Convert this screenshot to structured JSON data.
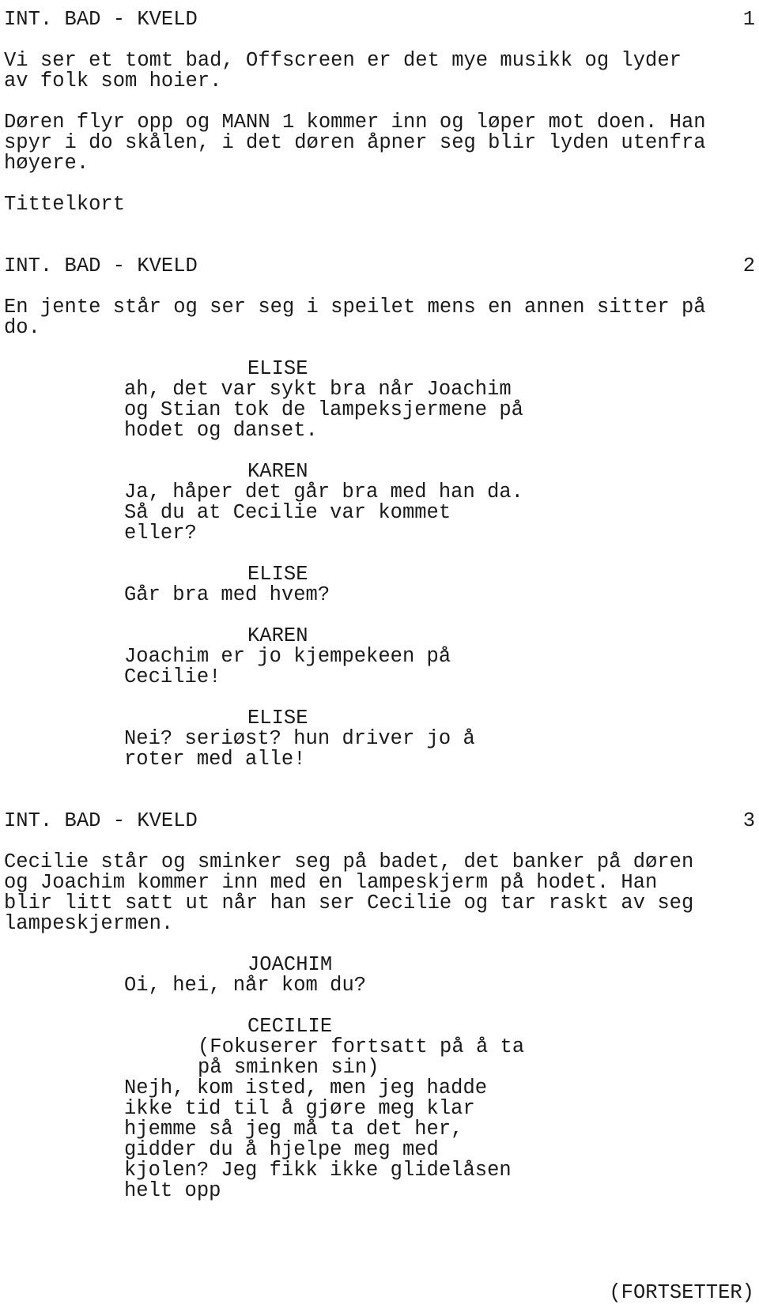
{
  "document": {
    "kind": "screenplay",
    "language": "Norwegian",
    "page_number_top_right": "1"
  },
  "footer": {
    "continued_label": "(FORTSETTER)"
  },
  "scene_numbers": {
    "scene1": "1",
    "scene2": "2",
    "scene3": "3"
  },
  "lines": [
    {
      "type": "scene",
      "text": "INT. BAD - KVELD",
      "page": "1"
    },
    {
      "type": "blank",
      "text": " "
    },
    {
      "type": "action",
      "text": "Vi ser et tomt bad, Offscreen er det mye musikk og lyder"
    },
    {
      "type": "action",
      "text": "av folk som hoier."
    },
    {
      "type": "blank",
      "text": " "
    },
    {
      "type": "action",
      "text": "Døren flyr opp og MANN 1 kommer inn og løper mot doen. Han"
    },
    {
      "type": "action",
      "text": "spyr i do skålen, i det døren åpner seg blir lyden utenfra"
    },
    {
      "type": "action",
      "text": "høyere."
    },
    {
      "type": "blank",
      "text": " "
    },
    {
      "type": "action",
      "text": "Tittelkort"
    },
    {
      "type": "blank",
      "text": " "
    },
    {
      "type": "blank",
      "text": " "
    },
    {
      "type": "scene",
      "text": "INT. BAD - KVELD",
      "page": "2"
    },
    {
      "type": "blank",
      "text": " "
    },
    {
      "type": "action",
      "text": "En jente står og ser seg i speilet mens en annen sitter på"
    },
    {
      "type": "action",
      "text": "do."
    },
    {
      "type": "blank",
      "text": " "
    },
    {
      "type": "character",
      "text": "ELISE"
    },
    {
      "type": "dialogue",
      "text": "ah, det var sykt bra når Joachim"
    },
    {
      "type": "dialogue",
      "text": "og Stian tok de lampeksjermene på"
    },
    {
      "type": "dialogue",
      "text": "hodet og danset."
    },
    {
      "type": "blank",
      "text": " "
    },
    {
      "type": "character",
      "text": "KAREN"
    },
    {
      "type": "dialogue",
      "text": "Ja, håper det går bra med han da."
    },
    {
      "type": "dialogue",
      "text": "Så du at Cecilie var kommet"
    },
    {
      "type": "dialogue",
      "text": "eller?"
    },
    {
      "type": "blank",
      "text": " "
    },
    {
      "type": "character",
      "text": "ELISE"
    },
    {
      "type": "dialogue",
      "text": "Går bra med hvem?"
    },
    {
      "type": "blank",
      "text": " "
    },
    {
      "type": "character",
      "text": "KAREN"
    },
    {
      "type": "dialogue",
      "text": "Joachim er jo kjempekeen på"
    },
    {
      "type": "dialogue",
      "text": "Cecilie!"
    },
    {
      "type": "blank",
      "text": " "
    },
    {
      "type": "character",
      "text": "ELISE"
    },
    {
      "type": "dialogue",
      "text": "Nei? seriøst? hun driver jo å"
    },
    {
      "type": "dialogue",
      "text": "roter med alle!"
    },
    {
      "type": "blank",
      "text": " "
    },
    {
      "type": "blank",
      "text": " "
    },
    {
      "type": "scene",
      "text": "INT. BAD - KVELD",
      "page": "3"
    },
    {
      "type": "blank",
      "text": " "
    },
    {
      "type": "action",
      "text": "Cecilie står og sminker seg på badet, det banker på døren"
    },
    {
      "type": "action",
      "text": "og Joachim kommer inn med en lampeskjerm på hodet. Han"
    },
    {
      "type": "action",
      "text": "blir litt satt ut når han ser Cecilie og tar raskt av seg"
    },
    {
      "type": "action",
      "text": "lampeskjermen."
    },
    {
      "type": "blank",
      "text": " "
    },
    {
      "type": "character",
      "text": "JOACHIM"
    },
    {
      "type": "dialogue",
      "text": "Oi, hei, når kom du?"
    },
    {
      "type": "blank",
      "text": " "
    },
    {
      "type": "character",
      "text": "CECILIE"
    },
    {
      "type": "paren",
      "text": "(Fokuserer fortsatt på å ta"
    },
    {
      "type": "paren",
      "text": "på sminken sin)"
    },
    {
      "type": "dialogue",
      "text": "Nejh, kom isted, men jeg hadde"
    },
    {
      "type": "dialogue",
      "text": "ikke tid til å gjøre meg klar"
    },
    {
      "type": "dialogue",
      "text": "hjemme så jeg må ta det her,"
    },
    {
      "type": "dialogue",
      "text": "gidder du å hjelpe meg med"
    },
    {
      "type": "dialogue",
      "text": "kjolen? Jeg fikk ikke glidelåsen"
    },
    {
      "type": "dialogue",
      "text": "helt opp"
    }
  ]
}
